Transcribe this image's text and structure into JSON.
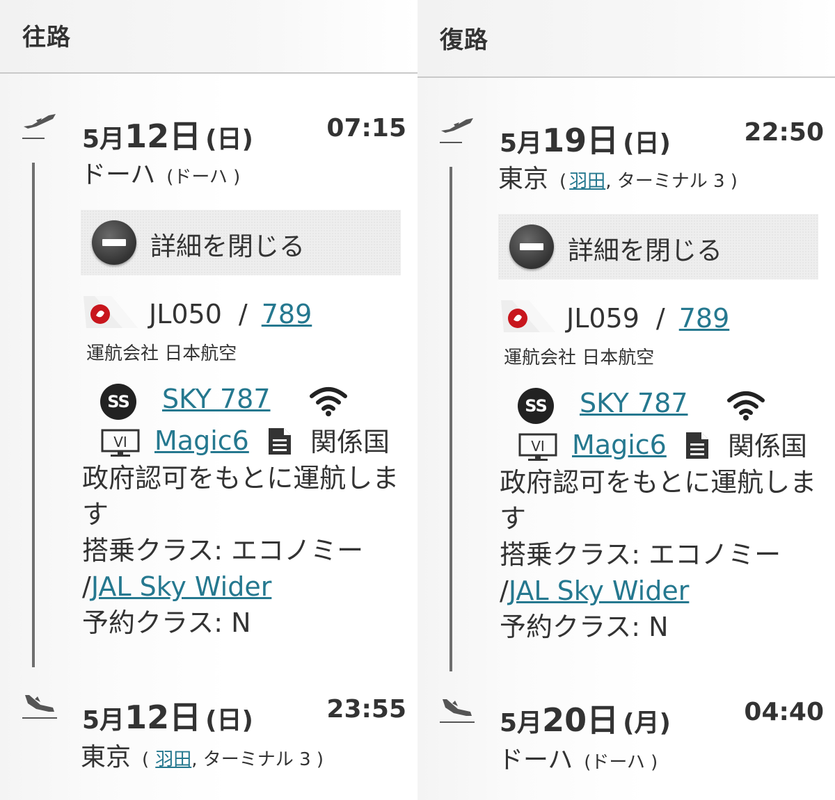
{
  "outbound": {
    "header": "往路",
    "departure": {
      "month": "5月",
      "day": "12日",
      "weekday": "(日)",
      "time": "07:15",
      "city": "ドーハ",
      "airport_paren": "(ドーハ )"
    },
    "details_toggle": "詳細を閉じる",
    "flight": {
      "number": "JL050",
      "separator": "/",
      "equipment": "789",
      "operated_by": "運航会社 日本航空"
    },
    "amenities": {
      "seat_icon_text": "SS",
      "seat_name": "SKY 787",
      "wifi": "wifi-icon",
      "entertainment_icon_text": "VI",
      "entertainment_name": "Magic6",
      "note": "関係国政府認可をもとに運航します"
    },
    "cabin": {
      "prefix": "搭乗クラス: エコノミー",
      "slash": "/",
      "seat_link": "JAL Sky Wider",
      "booking_class": "予約クラス: N"
    },
    "arrival": {
      "month": "5月",
      "day": "12日",
      "weekday": "(日)",
      "time": "23:55",
      "city": "東京",
      "paren_open": "(",
      "airport_link": "羽田",
      "terminal": ", ターミナル 3 )"
    }
  },
  "return": {
    "header": "復路",
    "departure": {
      "month": "5月",
      "day": "19日",
      "weekday": "(日)",
      "time": "22:50",
      "city": "東京",
      "paren_open": "(",
      "airport_link": "羽田",
      "terminal": ", ターミナル 3 )"
    },
    "details_toggle": "詳細を閉じる",
    "flight": {
      "number": "JL059",
      "separator": "/",
      "equipment": "789",
      "operated_by": "運航会社 日本航空"
    },
    "amenities": {
      "seat_icon_text": "SS",
      "seat_name": "SKY 787",
      "wifi": "wifi-icon",
      "entertainment_icon_text": "VI",
      "entertainment_name": "Magic6",
      "note": "関係国政府認可をもとに運航します"
    },
    "cabin": {
      "prefix": "搭乗クラス: エコノミー",
      "slash": "/",
      "seat_link": "JAL Sky Wider",
      "booking_class": "予約クラス: N"
    },
    "arrival": {
      "month": "5月",
      "day": "20日",
      "weekday": "(月)",
      "time": "04:40",
      "city": "ドーハ",
      "airport_paren": "(ドーハ )"
    }
  },
  "colors": {
    "link": "#25788f",
    "text": "#333333",
    "timeline": "#6e6e6e",
    "jal_red": "#c8161d"
  }
}
